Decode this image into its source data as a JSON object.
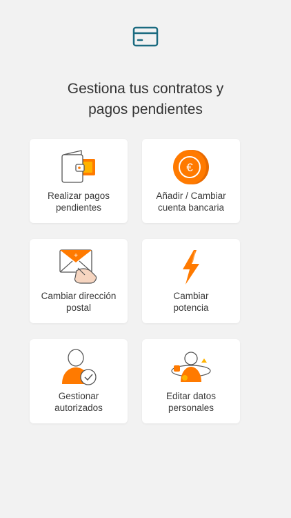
{
  "header": {
    "icon": "credit-card-icon",
    "title_line1": "Gestiona tus contratos y",
    "title_line2": "pagos pendientes"
  },
  "colors": {
    "accent": "#ff7a00",
    "teal": "#1b6b80",
    "background": "#f2f2f2",
    "card": "#ffffff",
    "text": "#3a3a3a"
  },
  "options": [
    {
      "icon": "wallet-icon",
      "line1": "Realizar pagos",
      "line2": "pendientes"
    },
    {
      "icon": "euro-coin-icon",
      "line1": "Añadir / Cambiar",
      "line2": "cuenta bancaria"
    },
    {
      "icon": "envelope-hand-icon",
      "line1": "Cambiar dirección",
      "line2": "postal"
    },
    {
      "icon": "lightning-bolt-icon",
      "line1": "Cambiar",
      "line2": "potencia"
    },
    {
      "icon": "authorized-user-icon",
      "line1": "Gestionar",
      "line2": "autorizados"
    },
    {
      "icon": "personal-data-user-icon",
      "line1": "Editar datos",
      "line2": "personales"
    }
  ]
}
